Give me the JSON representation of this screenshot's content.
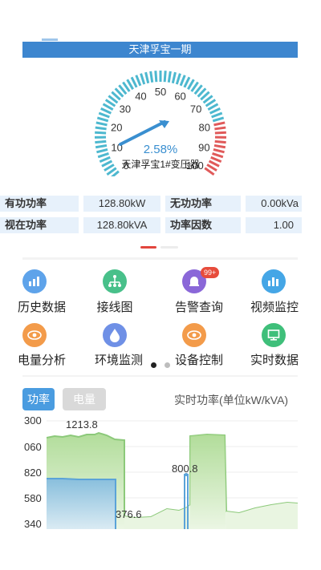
{
  "header": {
    "station": "天津孚宝一期"
  },
  "gauge": {
    "ticks": [
      "0",
      "10",
      "20",
      "30",
      "40",
      "50",
      "60",
      "70",
      "80",
      "90",
      "100"
    ],
    "value_text": "2.58%",
    "value": 2.58,
    "caption": "天津孚宝1#变压器"
  },
  "metrics": [
    {
      "label": "有功功率",
      "value": "128.80kW"
    },
    {
      "label": "无功功率",
      "value": "0.00kVa"
    },
    {
      "label": "视在功率",
      "value": "128.80kVA"
    },
    {
      "label": "功率因数",
      "value": "1.00"
    }
  ],
  "menu": {
    "row1": [
      {
        "label": "历史数据",
        "icon": "history-chart-icon",
        "color": "#5ea3ea"
      },
      {
        "label": "接线图",
        "icon": "wiring-diagram-icon",
        "color": "#48c08a"
      },
      {
        "label": "告警查询",
        "icon": "alarm-icon",
        "color": "#8a67d8",
        "badge": "99+"
      },
      {
        "label": "视频监控",
        "icon": "video-monitor-icon",
        "color": "#45a6e6"
      }
    ],
    "row2": [
      {
        "label": "电量分析",
        "icon": "energy-analysis-icon",
        "color": "#f39b4a"
      },
      {
        "label": "环境监测",
        "icon": "environment-icon",
        "color": "#6f90e6"
      },
      {
        "label": "设备控制",
        "icon": "device-control-icon",
        "color": "#f39b4a"
      },
      {
        "label": "实时数据",
        "icon": "realtime-data-icon",
        "color": "#3fbf7a"
      }
    ]
  },
  "tabs": {
    "power": "功率",
    "energy": "电量"
  },
  "chart_caption": "实时功率(单位kW/kVA)",
  "chart_data": {
    "type": "area",
    "y_ticks": [
      "300",
      "060",
      "820",
      "580",
      "340"
    ],
    "annotations": [
      "1213.8",
      "800.8",
      "376.6"
    ],
    "series": [
      {
        "color": "#8cc97a"
      },
      {
        "color": "#5ba3d8"
      }
    ]
  }
}
